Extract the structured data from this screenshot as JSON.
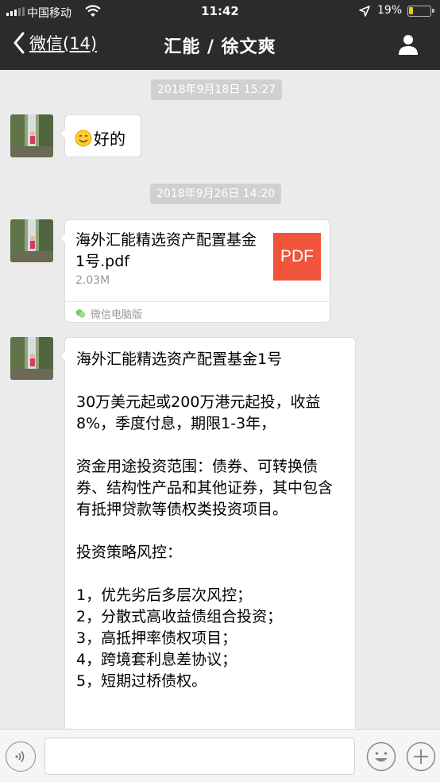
{
  "status_bar": {
    "carrier": "中国移动",
    "time": "11:42",
    "battery": "19%"
  },
  "nav": {
    "back_label": "微信(14)",
    "title": "汇能 / 徐文爽"
  },
  "messages": {
    "ts1": "2018年9月18日 15:27",
    "msg1_text": "好的",
    "ts2": "2018年9月26日 14:20",
    "file": {
      "name": "海外汇能精选资产配置基金1号.pdf",
      "size": "2.03M",
      "badge": "PDF",
      "source": "微信电脑版"
    },
    "long": {
      "p1": "海外汇能精选资产配置基金1号",
      "p2": "30万美元起或200万港元起投，收益8%，季度付息，期限1-3年，",
      "p3": "资金用途投资范围：债券、可转换债券、结构性产品和其他证券，其中包含有抵押贷款等债权类投资项目。",
      "p4": "投资策略风控：",
      "items": [
        "1，优先劣后多层次风控；",
        "2，分散式高收益债组合投资；",
        "3，高抵押率债权项目；",
        "4，跨境套利息差协议；",
        "5，短期过桥债权。"
      ]
    }
  },
  "icons": {
    "back": "chevron-left-icon",
    "profile": "person-icon",
    "voice": "voice-icon",
    "emoji": "emoji-icon",
    "plus": "plus-icon",
    "smile_emoji": "smile-emoji-icon"
  },
  "colors": {
    "nav_bg": "#2b2b2b",
    "chat_bg": "#ebebeb",
    "pdf_badge": "#f0553b"
  }
}
